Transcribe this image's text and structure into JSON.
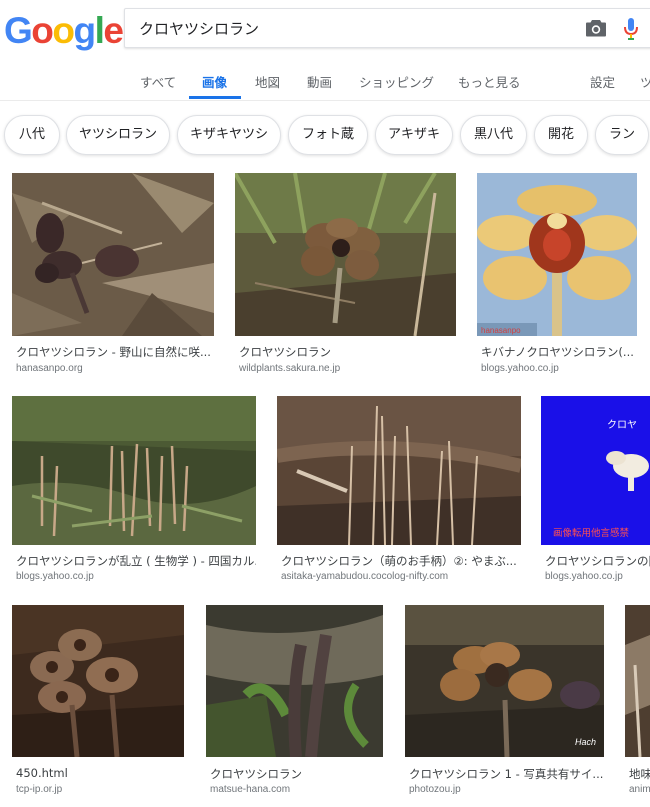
{
  "logo": {
    "letters": [
      "G",
      "o",
      "o",
      "g",
      "l",
      "e"
    ],
    "colors": [
      "#4285F4",
      "#EA4335",
      "#FBBC05",
      "#4285F4",
      "#34A853",
      "#EA4335"
    ]
  },
  "search": {
    "query": "クロヤツシロラン"
  },
  "tabs": [
    {
      "label": "すべて"
    },
    {
      "label": "画像"
    },
    {
      "label": "地図"
    },
    {
      "label": "動画"
    },
    {
      "label": "ショッピング"
    },
    {
      "label": "もっと見る"
    },
    {
      "label": "設定"
    },
    {
      "label": "ツ"
    }
  ],
  "chips": [
    "八代",
    "ヤツシロラン",
    "キザキヤツシ",
    "フォト蔵",
    "アキザキ",
    "黒八代",
    "開花",
    "ラン"
  ],
  "results": [
    {
      "caption": "クロヤツシロラン - 野山に自然に咲...",
      "source": "hanasanpo.org"
    },
    {
      "caption": "クロヤツシロラン",
      "source": "wildplants.sakura.ne.jp"
    },
    {
      "caption": "キバナノクロヤツシロラン(...",
      "source": "blogs.yahoo.co.jp"
    },
    {
      "caption": "クロヤツシロランが乱立 ( 生物学 ) - 四国カル...",
      "source": "blogs.yahoo.co.jp"
    },
    {
      "caption": "クロヤツシロラン（萌のお手柄）②: やまぶ...",
      "source": "asitaka-yamabudou.cocolog-nifty.com"
    },
    {
      "caption": "クロヤツシロランの開",
      "source": "blogs.yahoo.co.jp"
    },
    {
      "caption": "450.html",
      "source": "tcp-ip.or.jp"
    },
    {
      "caption": "クロヤツシロラン",
      "source": "matsue-hana.com"
    },
    {
      "caption": "クロヤツシロラン 1 - 写真共有サイ...",
      "source": "photozou.jp"
    },
    {
      "caption": "地味",
      "source": "anim"
    }
  ],
  "image_overlays": {
    "r3_watermark": "hanasanpo",
    "r6_text_top": "クロヤ",
    "r6_text_bottom": "画像転用他言感禁",
    "r9_watermark": "Hach"
  }
}
